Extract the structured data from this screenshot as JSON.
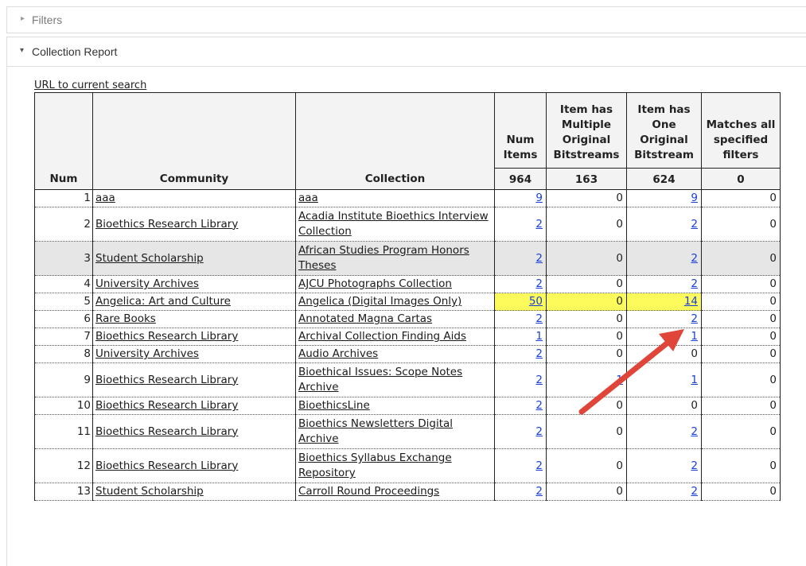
{
  "panels": {
    "filters_label": "Filters",
    "report_label": "Collection Report"
  },
  "url_link": "URL to current search",
  "headers": {
    "num": "Num",
    "community": "Community",
    "collection": "Collection",
    "num_items": "Num Items",
    "multi": "Item has Multiple Original Bitstreams",
    "one": "Item has One Original Bitstream",
    "matches": "Matches all specified filters"
  },
  "totals": {
    "num_items": "964",
    "multi": "163",
    "one": "624",
    "matches": "0"
  },
  "rows": [
    {
      "num": "1",
      "community": "aaa",
      "collection": "aaa",
      "items": "9",
      "multi": "0",
      "one": "9",
      "match": "0"
    },
    {
      "num": "2",
      "community": "Bioethics Research Library",
      "collection": "Acadia Institute Bioethics Interview Collection",
      "items": "2",
      "multi": "0",
      "one": "2",
      "match": "0"
    },
    {
      "num": "3",
      "community": "Student Scholarship",
      "collection": "African Studies Program Honors Theses",
      "items": "2",
      "multi": "0",
      "one": "2",
      "match": "0"
    },
    {
      "num": "4",
      "community": "University Archives",
      "collection": "AJCU Photographs Collection",
      "items": "2",
      "multi": "0",
      "one": "2",
      "match": "0"
    },
    {
      "num": "5",
      "community": "Angelica: Art and Culture",
      "collection": "Angelica (Digital Images Only)",
      "items": "50",
      "multi": "0",
      "one": "14",
      "match": "0"
    },
    {
      "num": "6",
      "community": "Rare Books",
      "collection": "Annotated Magna Cartas",
      "items": "2",
      "multi": "0",
      "one": "2",
      "match": "0"
    },
    {
      "num": "7",
      "community": "Bioethics Research Library",
      "collection": "Archival Collection Finding Aids",
      "items": "1",
      "multi": "0",
      "one": "1",
      "match": "0"
    },
    {
      "num": "8",
      "community": "University Archives",
      "collection": "Audio Archives",
      "items": "2",
      "multi": "0",
      "one": "0",
      "match": "0"
    },
    {
      "num": "9",
      "community": "Bioethics Research Library",
      "collection": "Bioethical Issues: Scope Notes Archive",
      "items": "2",
      "multi": "1",
      "one": "1",
      "match": "0"
    },
    {
      "num": "10",
      "community": "Bioethics Research Library",
      "collection": "BioethicsLine",
      "items": "2",
      "multi": "0",
      "one": "0",
      "match": "0"
    },
    {
      "num": "11",
      "community": "Bioethics Research Library",
      "collection": "Bioethics Newsletters Digital Archive",
      "items": "2",
      "multi": "0",
      "one": "2",
      "match": "0"
    },
    {
      "num": "12",
      "community": "Bioethics Research Library",
      "collection": "Bioethics Syllabus Exchange Repository",
      "items": "2",
      "multi": "0",
      "one": "2",
      "match": "0"
    },
    {
      "num": "13",
      "community": "Student Scholarship",
      "collection": "Carroll Round Proceedings",
      "items": "2",
      "multi": "0",
      "one": "2",
      "match": "0"
    }
  ],
  "colors": {
    "highlight": "#fdfb5c",
    "arrow": "#e0453a",
    "link_blue": "#1a3fd6",
    "grey_row": "#e6e6e6"
  }
}
